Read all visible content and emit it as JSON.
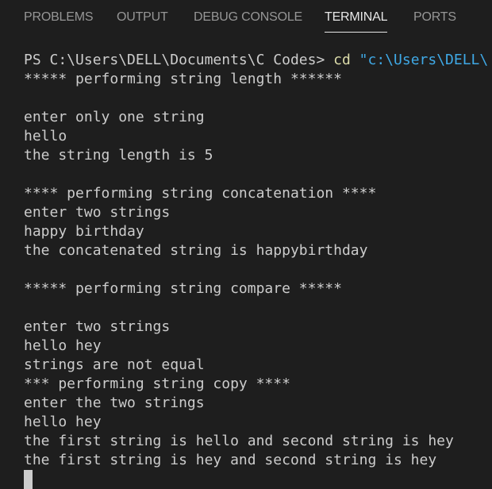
{
  "panel_tabs": [
    {
      "label": "PROBLEMS"
    },
    {
      "label": "OUTPUT"
    },
    {
      "label": "DEBUG CONSOLE"
    },
    {
      "label": "TERMINAL",
      "active": true
    },
    {
      "label": "PORTS"
    }
  ],
  "terminal": {
    "prompt": "PS C:\\Users\\DELL\\Documents\\C Codes>",
    "command": "cd",
    "argument": "\"c:\\Users\\DELL\\",
    "lines": [
      "***** performing string length ******",
      "",
      "enter only one string",
      "hello",
      "the string length is 5",
      "",
      "**** performing string concatenation ****",
      "enter two strings",
      "happy birthday",
      "the concatenated string is happybirthday",
      "",
      "***** performing string compare *****",
      "",
      "enter two strings",
      "hello hey",
      "strings are not equal",
      "*** performing string copy ****",
      "enter the two strings",
      "hello hey",
      "the first string is hello and second string is hey",
      "the first string is hey and second string is hey"
    ]
  },
  "colors": {
    "background": "#1e1e1e",
    "text": "#cccccc",
    "command": "#dcdcaa",
    "string_argument": "#3fa9e6",
    "active_tab": "#e7e7e7",
    "inactive_tab": "#969696"
  }
}
